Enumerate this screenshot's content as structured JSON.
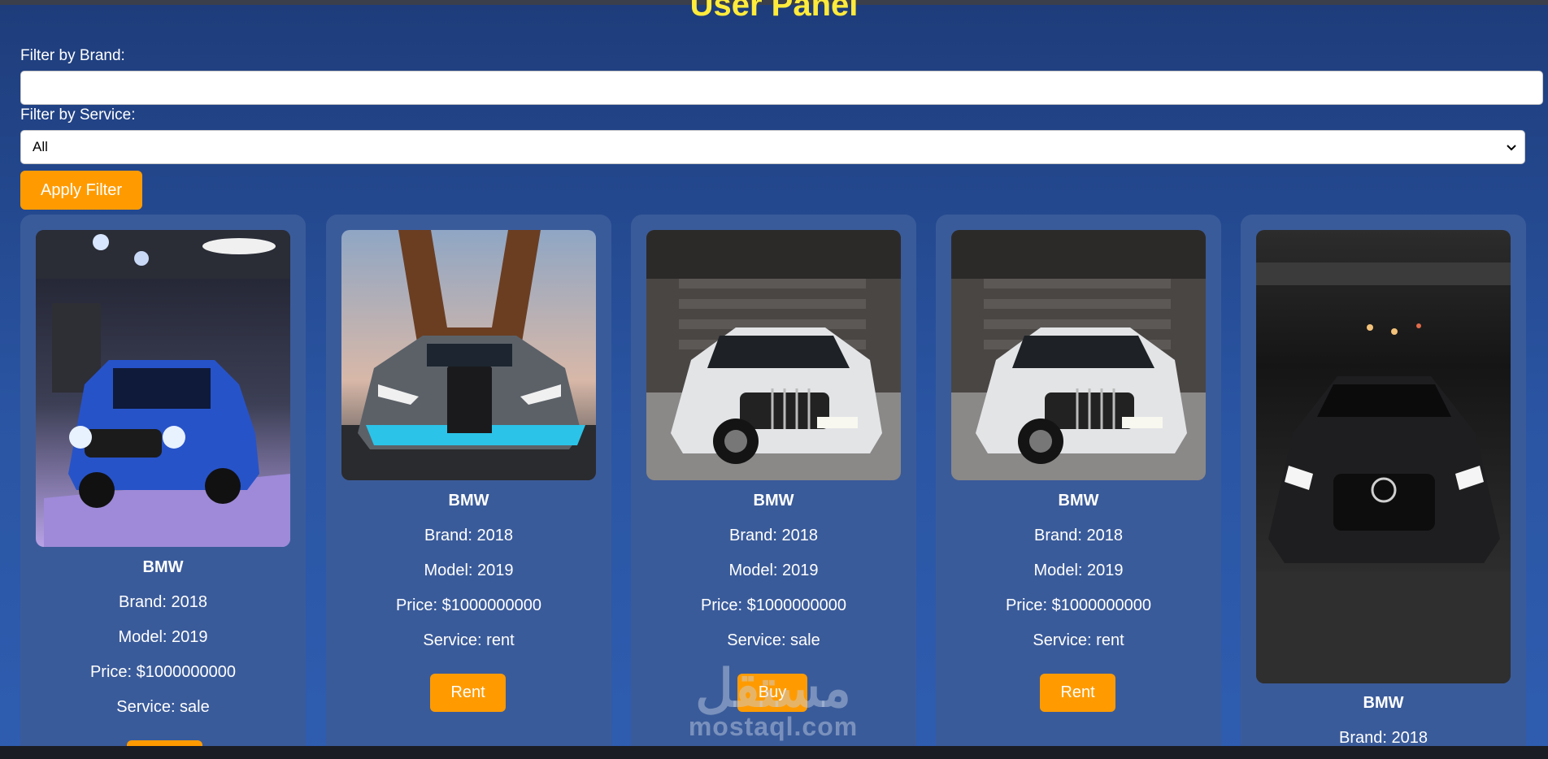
{
  "header": {
    "title": "User Panel"
  },
  "filters": {
    "brand_label": "Filter by Brand:",
    "brand_value": "",
    "service_label": "Filter by Service:",
    "service_selected": "All",
    "apply_label": "Apply Filter"
  },
  "cars": [
    {
      "name": "BMW",
      "brand": "Brand: 2018",
      "model": "Model: 2019",
      "price": "Price: $1000000000",
      "service": "Service: sale",
      "action": "",
      "photo": "blue-suv-showroom"
    },
    {
      "name": "BMW",
      "brand": "Brand: 2018",
      "model": "Model: 2019",
      "price": "Price: $1000000000",
      "service": "Service: rent",
      "action": "Rent",
      "photo": "grey-hypercar-eiffel-tower"
    },
    {
      "name": "BMW",
      "brand": "Brand: 2018",
      "model": "Model: 2019",
      "price": "Price: $1000000000",
      "service": "Service: sale",
      "action": "Buy",
      "photo": "white-sedan-stairs"
    },
    {
      "name": "BMW",
      "brand": "Brand: 2018",
      "model": "Model: 2019",
      "price": "Price: $1000000000",
      "service": "Service: rent",
      "action": "Rent",
      "photo": "white-sedan-stairs"
    },
    {
      "name": "BMW",
      "brand": "Brand: 2018",
      "photo": "black-sports-car-road"
    }
  ],
  "watermark": {
    "arabic": "مستقل",
    "site": "mostaql.com"
  },
  "colors": {
    "accent": "#ff9b00",
    "title": "#ffeb3b",
    "card": "#3a5b9a",
    "background": "#2a55a3"
  }
}
